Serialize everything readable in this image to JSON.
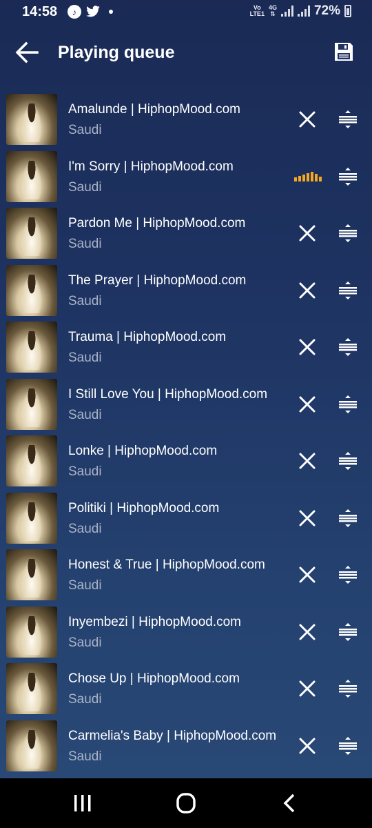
{
  "status_bar": {
    "time": "14:58",
    "network_top": "Vo",
    "network_bottom": "LTE1",
    "network_type": "4G",
    "battery": "72%"
  },
  "header": {
    "title": "Playing queue"
  },
  "icons": {
    "back": "arrow-left-icon",
    "save": "save-icon",
    "remove": "close-icon",
    "drag": "drag-handle-icon",
    "playing": "equalizer-icon"
  },
  "colors": {
    "background_top": "#1a2a55",
    "background_bottom": "#2a4a78",
    "accent_playing": "#f5a623",
    "artist_text": "#a9b3c6"
  },
  "queue": [
    {
      "title": "Amalunde | HiphopMood.com",
      "artist": "Saudi",
      "playing": false
    },
    {
      "title": "I'm Sorry | HiphopMood.com",
      "artist": "Saudi",
      "playing": true
    },
    {
      "title": "Pardon Me | HiphopMood.com",
      "artist": "Saudi",
      "playing": false
    },
    {
      "title": "The Prayer | HiphopMood.com",
      "artist": "Saudi",
      "playing": false
    },
    {
      "title": "Trauma | HiphopMood.com",
      "artist": "Saudi",
      "playing": false
    },
    {
      "title": "I Still Love You | HiphopMood.com",
      "artist": "Saudi",
      "playing": false
    },
    {
      "title": "Lonke | HiphopMood.com",
      "artist": "Saudi",
      "playing": false
    },
    {
      "title": "Politiki | HiphopMood.com",
      "artist": "Saudi",
      "playing": false
    },
    {
      "title": "Honest & True | HiphopMood.com",
      "artist": "Saudi",
      "playing": false
    },
    {
      "title": "Inyembezi | HiphopMood.com",
      "artist": "Saudi",
      "playing": false
    },
    {
      "title": "Chose Up | HiphopMood.com",
      "artist": "Saudi",
      "playing": false
    },
    {
      "title": "Carmelia's Baby | HiphopMood.com",
      "artist": "Saudi",
      "playing": false
    }
  ]
}
